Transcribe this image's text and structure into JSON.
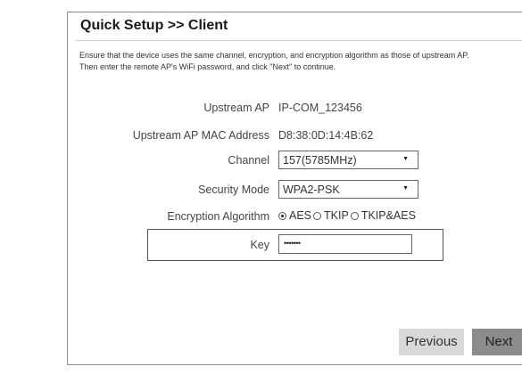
{
  "header": {
    "title": "Quick Setup >> Client"
  },
  "description": {
    "line1": "Ensure that the device uses the same channel, encryption, and encryption algorithm as those of upstream AP.",
    "line2": "Then enter the remote AP's WiFi password, and click \"Next\" to continue."
  },
  "form": {
    "upstream_ap_label": "Upstream AP",
    "upstream_ap_value": "IP-COM_123456",
    "mac_label": "Upstream AP MAC Address",
    "mac_value": "D8:38:0D:14:4B:62",
    "channel_label": "Channel",
    "channel_value": "157(5785MHz)",
    "security_label": "Security Mode",
    "security_value": "WPA2-PSK",
    "encryption_label": "Encryption Algorithm",
    "encryption_options": [
      "AES",
      "TKIP",
      "TKIP&AES"
    ],
    "encryption_selected": "AES",
    "key_label": "Key",
    "key_value": "•••••••"
  },
  "buttons": {
    "previous": "Previous",
    "next": "Next"
  }
}
